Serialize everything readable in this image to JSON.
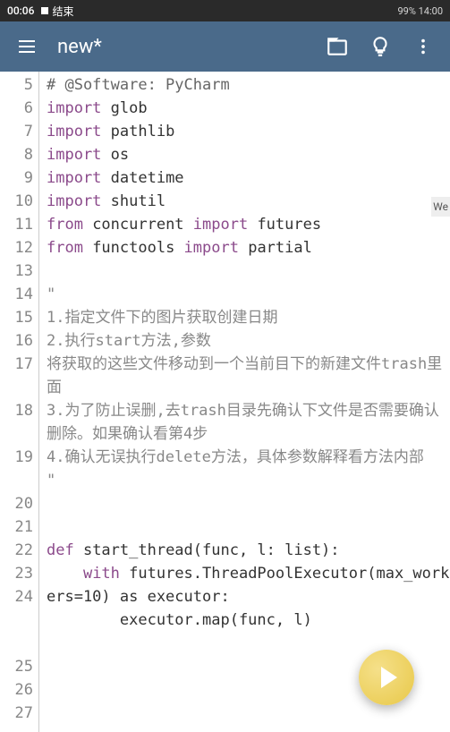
{
  "status": {
    "time": "00:06",
    "end_label": "结束",
    "right_text": "99%  14:00"
  },
  "appbar": {
    "title": "new*"
  },
  "side_text": "We",
  "code_lines": [
    {
      "n": 5,
      "pre": "# ",
      "kw": "",
      "rest": "@Software: PyCharm",
      "cls": "comment"
    },
    {
      "n": 6,
      "pre": "",
      "kw": "import",
      "rest": " glob"
    },
    {
      "n": 7,
      "pre": "",
      "kw": "import",
      "rest": " pathlib"
    },
    {
      "n": 8,
      "pre": "",
      "kw": "import",
      "rest": " os"
    },
    {
      "n": 9,
      "pre": "",
      "kw": "import",
      "rest": " datetime"
    },
    {
      "n": 10,
      "pre": "",
      "kw": "import",
      "rest": " shutil"
    },
    {
      "n": 11,
      "pre": "",
      "kw": "from",
      "rest": " concurrent ",
      "kw2": "import",
      "rest2": " futures"
    },
    {
      "n": 12,
      "pre": "",
      "kw": "from",
      "rest": " functools ",
      "kw2": "import",
      "rest2": " partial"
    },
    {
      "n": 13,
      "pre": "",
      "kw": "",
      "rest": ""
    },
    {
      "n": 14,
      "pre": "\"",
      "kw": "",
      "rest": "",
      "cls": "str"
    },
    {
      "n": 15,
      "pre": "1.指定文件下的图片获取创建日期",
      "cls": "str"
    },
    {
      "n": 16,
      "pre": "2.执行start方法,参数",
      "cls": "str"
    },
    {
      "n": 17,
      "pre": "将获取的这些文件移动到一个当前目下的新建文件trash里面",
      "cls": "str",
      "wrap": 1
    },
    {
      "n": 18,
      "pre": "3.为了防止误删,去trash目录先确认下文件是否需要确认删除。如果确认看第4步",
      "cls": "str",
      "wrap": 1
    },
    {
      "n": 19,
      "pre": "4.确认无误执行delete方法，具体参数解释看方法内部",
      "cls": "str",
      "wrap": 1
    },
    {
      "n": 20,
      "pre": "\"",
      "cls": "str"
    },
    {
      "n": 21,
      "pre": ""
    },
    {
      "n": 22,
      "pre": ""
    },
    {
      "n": 23,
      "pre": "",
      "kw": "def",
      "rest": " start_thread(func, l: list):"
    },
    {
      "n": 24,
      "pre": "    ",
      "kw": "with",
      "rest": " futures.ThreadPoolExecutor(max_workers=10) as executor:",
      "wrap": 2
    },
    {
      "n": 25,
      "pre": "        executor.map(func, l)"
    },
    {
      "n": 26,
      "pre": ""
    },
    {
      "n": 27,
      "pre": ""
    }
  ]
}
